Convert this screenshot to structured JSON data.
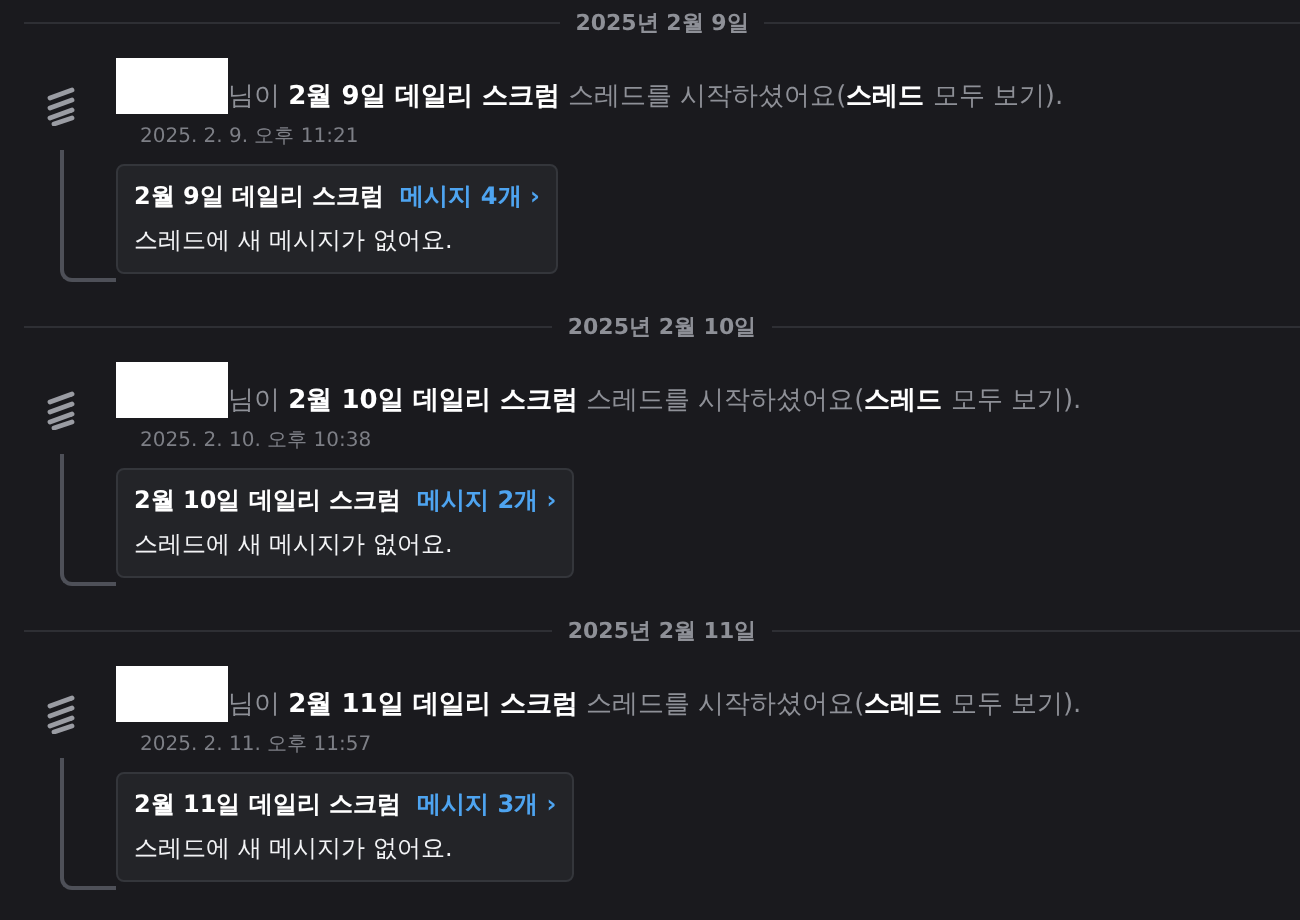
{
  "entries": [
    {
      "date": "2025년 2월 9일",
      "message": "님이 **2월 9일 데일리 스크럼** 스레드를 시작하셨어요(**스레드** 모두 보기).",
      "timestamp": "2025. 2. 9. 오후 11:21",
      "thread": {
        "title": "2월 9일 데일리 스크럼",
        "link": "메시지 4개 ›",
        "status": "스레드에 새 메시지가 없어요."
      }
    },
    {
      "date": "2025년 2월 10일",
      "message": "님이 **2월 10일 데일리 스크럼** 스레드를 시작하셨어요(**스레드** 모두 보기).",
      "timestamp": "2025. 2. 10. 오후 10:38",
      "thread": {
        "title": "2월 10일 데일리 스크럼",
        "link": "메시지 2개 ›",
        "status": "스레드에 새 메시지가 없어요."
      }
    },
    {
      "date": "2025년 2월 11일",
      "message": "님이 **2월 11일 데일리 스크럼** 스레드를 시작하셨어요(**스레드** 모두 보기).",
      "timestamp": "2025. 2. 11. 오후 11:57",
      "thread": {
        "title": "2월 11일 데일리 스크럼",
        "link": "메시지 3개 ›",
        "status": "스레드에 새 메시지가 없어요."
      }
    }
  ]
}
